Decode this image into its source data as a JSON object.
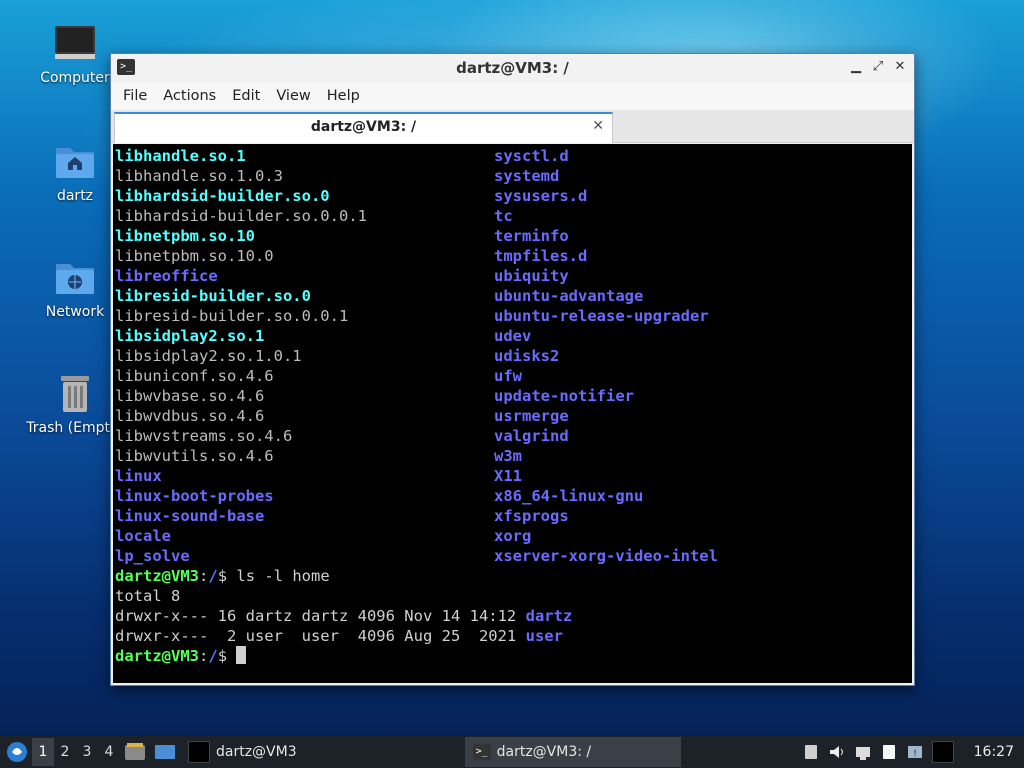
{
  "desktop": {
    "icons": [
      {
        "label": "Computer",
        "icon": "computer-icon"
      },
      {
        "label": "dartz",
        "icon": "home-folder-icon"
      },
      {
        "label": "Network",
        "icon": "network-folder-icon"
      },
      {
        "label": "Trash (Empty)",
        "icon": "trash-icon"
      }
    ]
  },
  "window": {
    "title": "dartz@VM3: /",
    "controls": {
      "minimize": "▁",
      "maximize": "⤢",
      "close": "✕"
    },
    "menu": [
      "File",
      "Actions",
      "Edit",
      "View",
      "Help"
    ],
    "tab": {
      "label": "dartz@VM3: /",
      "close": "✕"
    }
  },
  "terminal": {
    "left_column": [
      {
        "text": "libhandle.so.1",
        "style": "cyan"
      },
      {
        "text": "libhandle.so.1.0.3",
        "style": "gray"
      },
      {
        "text": "libhardsid-builder.so.0",
        "style": "cyan"
      },
      {
        "text": "libhardsid-builder.so.0.0.1",
        "style": "gray"
      },
      {
        "text": "libnetpbm.so.10",
        "style": "cyan"
      },
      {
        "text": "libnetpbm.so.10.0",
        "style": "gray"
      },
      {
        "text": "libreoffice",
        "style": "blue"
      },
      {
        "text": "libresid-builder.so.0",
        "style": "cyan"
      },
      {
        "text": "libresid-builder.so.0.0.1",
        "style": "gray"
      },
      {
        "text": "libsidplay2.so.1",
        "style": "cyan"
      },
      {
        "text": "libsidplay2.so.1.0.1",
        "style": "gray"
      },
      {
        "text": "libuniconf.so.4.6",
        "style": "gray"
      },
      {
        "text": "libwvbase.so.4.6",
        "style": "gray"
      },
      {
        "text": "libwvdbus.so.4.6",
        "style": "gray"
      },
      {
        "text": "libwvstreams.so.4.6",
        "style": "gray"
      },
      {
        "text": "libwvutils.so.4.6",
        "style": "gray"
      },
      {
        "text": "linux",
        "style": "blue"
      },
      {
        "text": "linux-boot-probes",
        "style": "blue"
      },
      {
        "text": "linux-sound-base",
        "style": "blue"
      },
      {
        "text": "locale",
        "style": "blue"
      },
      {
        "text": "lp_solve",
        "style": "blue"
      }
    ],
    "right_column": [
      {
        "text": "sysctl.d",
        "style": "blue"
      },
      {
        "text": "systemd",
        "style": "blue"
      },
      {
        "text": "sysusers.d",
        "style": "blue"
      },
      {
        "text": "tc",
        "style": "blue"
      },
      {
        "text": "terminfo",
        "style": "blue"
      },
      {
        "text": "tmpfiles.d",
        "style": "blue"
      },
      {
        "text": "ubiquity",
        "style": "blue"
      },
      {
        "text": "ubuntu-advantage",
        "style": "blue"
      },
      {
        "text": "ubuntu-release-upgrader",
        "style": "blue"
      },
      {
        "text": "udev",
        "style": "blue"
      },
      {
        "text": "udisks2",
        "style": "blue"
      },
      {
        "text": "ufw",
        "style": "blue"
      },
      {
        "text": "update-notifier",
        "style": "blue"
      },
      {
        "text": "usrmerge",
        "style": "blue"
      },
      {
        "text": "valgrind",
        "style": "blue"
      },
      {
        "text": "w3m",
        "style": "blue"
      },
      {
        "text": "X11",
        "style": "blue"
      },
      {
        "text": "x86_64-linux-gnu",
        "style": "blue"
      },
      {
        "text": "xfsprogs",
        "style": "blue"
      },
      {
        "text": "xorg",
        "style": "blue"
      },
      {
        "text": "xserver-xorg-video-intel",
        "style": "blue"
      }
    ],
    "prompt_user": "dartz@VM3",
    "prompt_sep": ":",
    "prompt_path": "/",
    "prompt_symbol": "$ ",
    "command": "ls -l home",
    "total_line": "total 8",
    "listing": [
      {
        "prefix": "drwxr-x--- 16 dartz dartz 4096 Nov 14 14:12 ",
        "name": "dartz"
      },
      {
        "prefix": "drwxr-x---  2 user  user  4096 Aug 25  2021 ",
        "name": "user"
      }
    ]
  },
  "taskbar": {
    "workspaces": [
      "1",
      "2",
      "3",
      "4"
    ],
    "active_workspace": "1",
    "tasks": [
      {
        "label": "dartz@VM3",
        "active": false
      },
      {
        "label": "dartz@VM3: /",
        "active": true
      }
    ],
    "clock": "16:27"
  },
  "colors": {
    "accent": "#3c8bd6",
    "terminal_bg": "#000000",
    "ls_symlink": "#55ffff",
    "ls_dir": "#6b6bff",
    "prompt": "#55ff55"
  }
}
